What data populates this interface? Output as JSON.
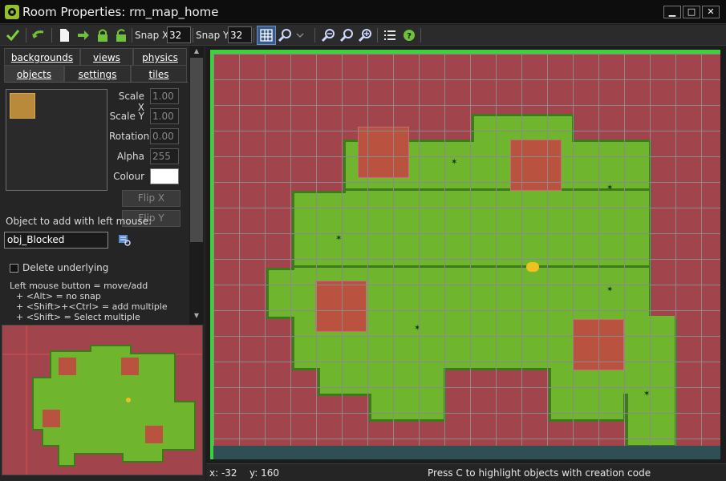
{
  "window": {
    "title": "Room Properties: rm_map_home",
    "controls": {
      "minimize": "▁",
      "maximize": "□",
      "close": "✕"
    }
  },
  "toolbar": {
    "snap_x_label": "Snap X:",
    "snap_x_value": "32",
    "snap_y_label": "Snap Y:",
    "snap_y_value": "32",
    "icons": [
      "confirm-check-icon",
      "undo-icon",
      "new-page-icon",
      "arrow-right-icon",
      "lock-icon",
      "unlock-icon",
      "grid-toggle-icon",
      "zoom-dropdown-icon",
      "zoom-out-icon",
      "zoom-reset-icon",
      "zoom-in-icon",
      "list-icon",
      "help-icon"
    ]
  },
  "tabs": {
    "backgrounds": "backgrounds",
    "views": "views",
    "physics": "physics",
    "objects": "objects",
    "settings": "settings",
    "tiles": "tiles"
  },
  "properties": {
    "scale_x_label": "Scale X",
    "scale_x_value": "1.00",
    "scale_y_label": "Scale Y",
    "scale_y_value": "1.00",
    "rotation_label": "Rotation",
    "rotation_value": "0.00",
    "alpha_label": "Alpha",
    "alpha_value": "255",
    "colour_label": "Colour",
    "colour_value": "#ffffff",
    "flip_x_label": "Flip X",
    "flip_y_label": "Flip Y"
  },
  "object_selector": {
    "label": "Object to add with left mouse:",
    "value": "obj_Blocked"
  },
  "delete_underlying": {
    "label": "Delete underlying",
    "checked": false
  },
  "help_text": {
    "line1": "Left mouse button = move/add",
    "line2": "+ <Alt> = no snap",
    "line3": "+ <Shift>+<Ctrl> = add multiple",
    "line4": "+ <Shift> = Select multiple"
  },
  "statusbar": {
    "x": "x: -32",
    "y": "y: 160",
    "message": "Press C to highlight objects with creation code"
  },
  "colors": {
    "room_background": "#a2444c",
    "grass": "#6fb52e",
    "selection_border": "#3cd23c",
    "water": "#2f4f55"
  }
}
